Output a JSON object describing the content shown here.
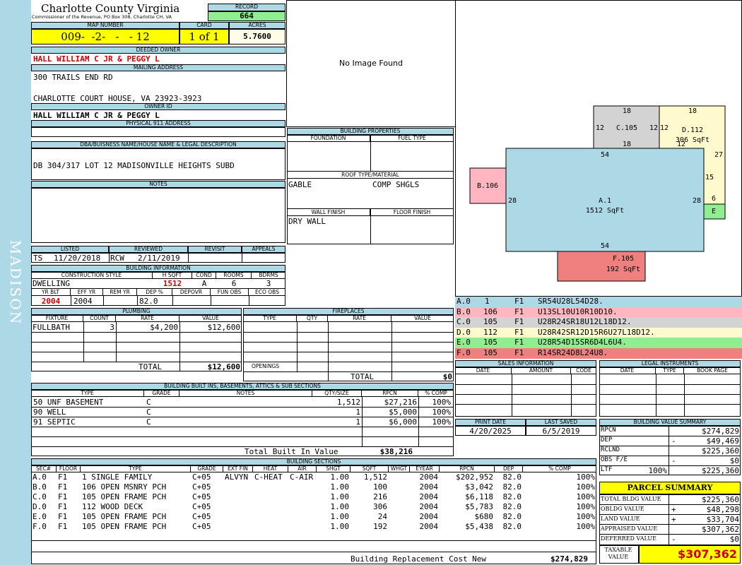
{
  "sidebar": {
    "text": "MADISON"
  },
  "county": {
    "name": "Charlotte County Virginia",
    "address": "Commissioner of the Revenue, PO Box 308, Charlotte CH, VA"
  },
  "record": {
    "label": "RECORD",
    "value": "664"
  },
  "map": {
    "label": "MAP NUMBER",
    "value": "009-  -2-   -   - 12"
  },
  "card": {
    "label": "CARD",
    "value": "1 of 1"
  },
  "acres": {
    "label": "ACRES",
    "value": "5.7600"
  },
  "owner": {
    "label": "DEEDED OWNER",
    "value": "HALL WILLIAM C JR & PEGGY L"
  },
  "mailing": {
    "label": "MAILING ADDRESS",
    "line1": "300 TRAILS END RD",
    "line2": "CHARLOTTE COURT HOUSE, VA 23923-3923"
  },
  "owner_id": {
    "label": "OWNER ID",
    "value": "HALL WILLIAM C JR & PEGGY L"
  },
  "physical": {
    "label": "PHYSICAL 911 ADDRESS",
    "value": ""
  },
  "legal": {
    "label": "DBA/BUISNESS NAME/HOUSE NAME & LEGAL DESCRIPTION",
    "value": "DB 304/317 LOT 12 MADISONVILLE HEIGHTS SUBD"
  },
  "notes": {
    "label": "NOTES",
    "value": ""
  },
  "photo": {
    "text": "No Image Found"
  },
  "review": {
    "listed_label": "LISTED",
    "reviewed_label": "REVIEWED",
    "revisit_label": "REVISIT",
    "appeals_label": "APPEALS",
    "listed_by": "TS",
    "listed_date": "11/20/2018",
    "reviewed_by": "RCW",
    "reviewed_date": "2/11/2019"
  },
  "building_info": {
    "label": "BUILDING INFORMATION",
    "h_style": "CONSTRUCTION STYLE",
    "h_hsqft": "H SQFT",
    "h_cond": "COND",
    "h_rooms": "ROOMS",
    "h_bdrms": "BDRMS",
    "style": "DWELLING",
    "hsqft": "1512",
    "cond": "A",
    "rooms": "6",
    "bdrms": "3",
    "h_yrblt": "YR BLT",
    "h_effyr": "EFF YR",
    "h_remyr": "REM YR",
    "h_dep": "DEP %",
    "h_depovr": "DEPOVR",
    "h_funobs": "FUN OBS",
    "h_ecoobs": "ECO OBS",
    "yrblt": "2004",
    "effyr": "2004",
    "dep": "82.0"
  },
  "properties": {
    "label": "BUILDING PROPERTIES",
    "foundation_label": "FOUNDATION",
    "fuel_label": "FUEL TYPE",
    "roof_label": "ROOF TYPE/MATERIAL",
    "roof_type": "GABLE",
    "roof_material": "COMP SHGLS",
    "wall_label": "WALL FINISH",
    "floor_label": "FLOOR FINISH",
    "wall": "DRY WALL"
  },
  "sketch": {
    "labels": [
      "18",
      "18",
      "12",
      "C.105",
      "12",
      "12",
      "D.112",
      "306 SqFt",
      "12",
      "18",
      "54",
      "27",
      "15",
      "B.106",
      "28",
      "A.1",
      "1512 SqFt",
      "28",
      "6",
      "E",
      "54",
      "F.105",
      "192 SqFt"
    ]
  },
  "segments": [
    {
      "id": "A.0",
      "area": "1",
      "floor": "F1",
      "code": "SR54U28L54D28.",
      "color": "#add8e6"
    },
    {
      "id": "B.0",
      "area": "106",
      "floor": "F1",
      "code": "U13SL10U10R10D10.",
      "color": "#ffb6c1"
    },
    {
      "id": "C.0",
      "area": "105",
      "floor": "F1",
      "code": "U28R24SR18U12L18D12.",
      "color": "#d3d3d3"
    },
    {
      "id": "D.0",
      "area": "112",
      "floor": "F1",
      "code": "U28R42SR12D15R6U27L18D12.",
      "color": "#fffacd"
    },
    {
      "id": "E.0",
      "area": "105",
      "floor": "F1",
      "code": "U28R54D15SR6D4L6U4.",
      "color": "#90ee90"
    },
    {
      "id": "F.0",
      "area": "105",
      "floor": "F1",
      "code": "R14SR24D8L24U8.",
      "color": "#f08080"
    }
  ],
  "plumbing": {
    "label": "PLUMBING",
    "h_fixture": "FIXTURE",
    "h_count": "COUNT",
    "h_rate": "RATE",
    "h_value": "VALUE",
    "rows": [
      {
        "fixture": "FULLBATH",
        "count": "3",
        "rate": "$4,200",
        "value": "$12,600"
      }
    ],
    "total_label": "TOTAL",
    "total": "$12,600"
  },
  "fireplaces": {
    "label": "FIREPLACES",
    "h_type": "TYPE",
    "h_qty": "QTY",
    "h_rate": "RATE",
    "h_value": "VALUE",
    "openings_label": "OPENINGS",
    "total_label": "TOTAL",
    "total": "$0"
  },
  "sales": {
    "label": "SALES INFORMATION",
    "h_date": "DATE",
    "h_amount": "AMOUNT",
    "h_code": "CODE"
  },
  "legal_inst": {
    "label": "LEGAL INSTRUMENTS",
    "h_date": "DATE",
    "h_type": "TYPE",
    "h_bookpage": "BOOK PAGE"
  },
  "builtins": {
    "label": "BUILDING BUILT INS, BASEMENTS, ATTICS & SUB SECTIONS",
    "h_type": "TYPE",
    "h_grade": "GRADE",
    "h_notes": "NOTES",
    "h_qty": "QTY/SIZE",
    "h_rpcn": "RPCN",
    "h_comp": "% COMP",
    "rows": [
      {
        "type": "50 UNF BASEMENT",
        "grade": "C",
        "notes": "",
        "qty": "1,512",
        "rpcn": "$27,216",
        "comp": "100%"
      },
      {
        "type": "90 WELL",
        "grade": "C",
        "notes": "",
        "qty": "1",
        "rpcn": "$5,000",
        "comp": "100%"
      },
      {
        "type": "91 SEPTIC",
        "grade": "C",
        "notes": "",
        "qty": "1",
        "rpcn": "$6,000",
        "comp": "100%"
      }
    ],
    "total_label": "Total Built In Value",
    "total": "$38,216"
  },
  "print": {
    "print_label": "PRINT DATE",
    "saved_label": "LAST SAVED",
    "print_date": "4/20/2025",
    "saved_date": "6/5/2019"
  },
  "value_summary": {
    "label": "BUILDING VALUE SUMMARY",
    "rows": [
      {
        "label": "RPCN",
        "pct": "",
        "sign": "",
        "value": "$274,829"
      },
      {
        "label": "DEP",
        "pct": "",
        "sign": "-",
        "value": "$49,469"
      },
      {
        "label": "RCLND",
        "pct": "",
        "sign": "",
        "value": "$225,360"
      },
      {
        "label": "OBS F/E",
        "pct": "",
        "sign": "-",
        "value": "$0"
      },
      {
        "label": "LTF",
        "pct": "100%",
        "sign": "",
        "value": "$225,360"
      }
    ]
  },
  "parcel": {
    "label": "PARCEL SUMMARY",
    "rows": [
      {
        "label": "TOTAL BLDG VALUE",
        "sign": "",
        "value": "$225,360"
      },
      {
        "label": "OBLDG VALUE",
        "sign": "+",
        "value": "$48,298"
      },
      {
        "label": "LAND VALUE",
        "sign": "+",
        "value": "$33,704"
      },
      {
        "label": "APPRAISED VALUE",
        "sign": "",
        "value": "$307,362"
      },
      {
        "label": "DEFERRED VALUE",
        "sign": "-",
        "value": "$0"
      }
    ],
    "taxable_label": "TAXABLE VALUE",
    "taxable": "$307,362"
  },
  "sections": {
    "label": "BUILDING SECTIONS",
    "headers": [
      "SEC#",
      "FLOOR",
      "TYPE",
      "GRADE",
      "EXT FIN",
      "HEAT",
      "AIR",
      "SHGT",
      "SQFT",
      "WHGT",
      "EYEAR",
      "RPCN",
      "DEP",
      "% COMP"
    ],
    "rows": [
      [
        "A.0",
        "F1",
        "1 SINGLE FAMILY",
        "C+05",
        "ALVYN",
        "C-HEAT",
        "C-AIR",
        "1.00",
        "1,512",
        "",
        "2004",
        "$202,952",
        "82.0",
        "100%"
      ],
      [
        "B.0",
        "F1",
        "106 OPEN MSNRY PCH",
        "C+05",
        "",
        "",
        "",
        "1.00",
        "100",
        "",
        "2004",
        "$3,042",
        "82.0",
        "100%"
      ],
      [
        "C.0",
        "F1",
        "105 OPEN FRAME PCH",
        "C+05",
        "",
        "",
        "",
        "1.00",
        "216",
        "",
        "2004",
        "$6,118",
        "82.0",
        "100%"
      ],
      [
        "D.0",
        "F1",
        "112 WOOD DECK",
        "C+05",
        "",
        "",
        "",
        "1.00",
        "306",
        "",
        "2004",
        "$5,783",
        "82.0",
        "100%"
      ],
      [
        "E.0",
        "F1",
        "105 OPEN FRAME PCH",
        "C+05",
        "",
        "",
        "",
        "1.00",
        "24",
        "",
        "2004",
        "$680",
        "82.0",
        "100%"
      ],
      [
        "F.0",
        "F1",
        "105 OPEN FRAME PCH",
        "C+05",
        "",
        "",
        "",
        "1.00",
        "192",
        "",
        "2004",
        "$5,438",
        "82.0",
        "100%"
      ]
    ],
    "total_label": "Building Replacement Cost New",
    "total": "$274,829"
  }
}
